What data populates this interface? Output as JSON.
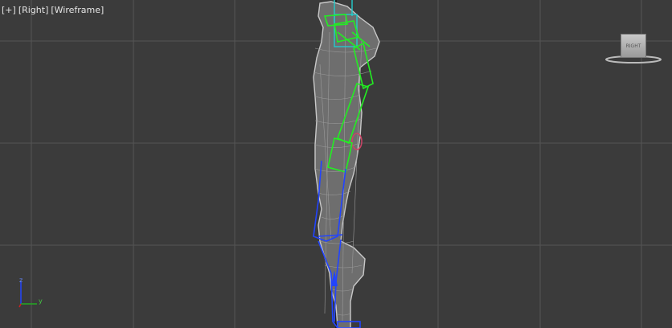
{
  "viewport": {
    "labels": [
      "[+]",
      "[Right]",
      "[Wireframe]"
    ],
    "background": "#3b3b3b",
    "grid_color": "#555555"
  },
  "viewcube": {
    "face_label": "RIGHT"
  },
  "axis_tripod": {
    "z": "z",
    "y": "y"
  },
  "colors": {
    "mesh": "#c8c8c8",
    "arm_bones": "#22ee22",
    "leg_bones": "#2244ff",
    "spine": "#22cccc",
    "hand": "#cc4466"
  }
}
